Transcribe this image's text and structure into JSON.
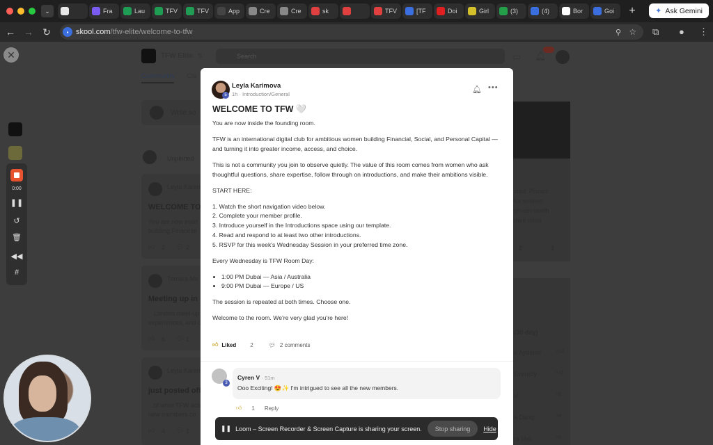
{
  "browser": {
    "tabs": [
      {
        "label": "",
        "color": "#e8e8e8"
      },
      {
        "label": "Fra",
        "color": "#7b5cf0"
      },
      {
        "label": "Lau",
        "color": "#1f9d55"
      },
      {
        "label": "TFV",
        "color": "#1f9d55"
      },
      {
        "label": "TFV",
        "color": "#1f9d55"
      },
      {
        "label": "App",
        "color": "#444444"
      },
      {
        "label": "Cre",
        "color": "#888888"
      },
      {
        "label": "Cre",
        "color": "#888888"
      },
      {
        "label": "sk",
        "color": "#e04040"
      },
      {
        "label": "",
        "color": "#e04040"
      },
      {
        "label": "TFV",
        "color": "#e04040"
      },
      {
        "label": "[TF",
        "color": "#3b6fe0"
      },
      {
        "label": "Doi",
        "color": "#e02020"
      },
      {
        "label": "Girl",
        "color": "#d4c02a"
      },
      {
        "label": "(3)",
        "color": "#25a04a"
      },
      {
        "label": "(4)",
        "color": "#3b6fe0"
      },
      {
        "label": "Bor",
        "color": "#ffffff"
      },
      {
        "label": "Goi",
        "color": "#3b6fe0"
      }
    ],
    "gemini_label": "Ask Gemini",
    "url_host": "skool.com",
    "url_path": "/tfw-elite/welcome-to-tfw"
  },
  "background": {
    "group_name": "TFW Elite",
    "search_placeholder": "Search",
    "nav_tab_1": "Community",
    "nav_tab_2": "Cla",
    "write_placeholder": "Write so",
    "pinned_label": "Unpinned",
    "feed": [
      {
        "author": "Leyla Karim",
        "title": "WELCOME TO",
        "snippet1": "You are now insid",
        "snippet2": "building Financial",
        "likes": "2",
        "comments": "2"
      },
      {
        "author": "Tamara Me",
        "title": "Meeting up in",
        "snippet1": "London meet-up",
        "snippet2": "experiences, and c",
        "likes": "6",
        "comments": "1"
      },
      {
        "author": "Leyla Karim",
        "title": "just posted off",
        "snippet1": "...of what TFW actu",
        "snippet2": "new members co",
        "likes": "4",
        "comments": "1"
      }
    ],
    "right_snippets": [
      "sted. Private",
      "for women",
      "gh-net-worth",
      "their most"
    ],
    "right_stats": [
      "2",
      "1"
    ],
    "leaderboard_title": "(30-day)",
    "leaderboard": [
      {
        "name": "e Aydemir",
        "pts": "+13"
      },
      {
        "name": "Everetty",
        "pts": "+11"
      },
      {
        "name": "V",
        "pts": "+8"
      },
      {
        "name": "a Dang",
        "pts": "+8"
      },
      {
        "name": "ra Mei",
        "pts": "+5"
      }
    ],
    "records_time": "0:00"
  },
  "post": {
    "author": "Leyla Karimova",
    "level": "5",
    "time": "1h",
    "category": "Introduction/General",
    "title": "WELCOME TO TFW 🤍",
    "p1": "You are now inside the founding room.",
    "p2": "TFW is an international digital club for ambitious women building Financial, Social, and Personal Capital — and turning it into greater income, access, and choice.",
    "p3": "This is not a community you join to observe quietly. The value of this room comes from women who ask thoughtful questions, share expertise, follow through on introductions, and make their ambitions visible.",
    "p4": "START HERE:",
    "steps": [
      "1. Watch the short navigation video below.",
      "2. Complete your member profile.",
      "3. Introduce yourself in the Introductions space using our template.",
      "4. Read and respond to at least two other introductions.",
      "5. RSVP for this week's Wednesday Session in your preferred time zone."
    ],
    "p5": "Every Wednesday is TFW Room Day:",
    "sessions": [
      "1:00 PM Dubai — Asia / Australia",
      "9:00 PM Dubai — Europe / US"
    ],
    "p6": "The session is repeated at both times. Choose one.",
    "p7": "Welcome to the room. We're very glad you're here!",
    "like_label": "Liked",
    "like_count": "2",
    "comments_label": "2 comments"
  },
  "comment": {
    "author": "Cyren V",
    "level": "3",
    "time": "51m",
    "text": "Ooo Exciting! 😍✨ I'm intrigued to see all the new members.",
    "like_count": "1",
    "reply_label": "Reply"
  },
  "loom_bar": {
    "message": "Loom – Screen Recorder & Screen Capture is sharing your screen.",
    "stop_label": "Stop sharing",
    "hide_label": "Hide"
  }
}
